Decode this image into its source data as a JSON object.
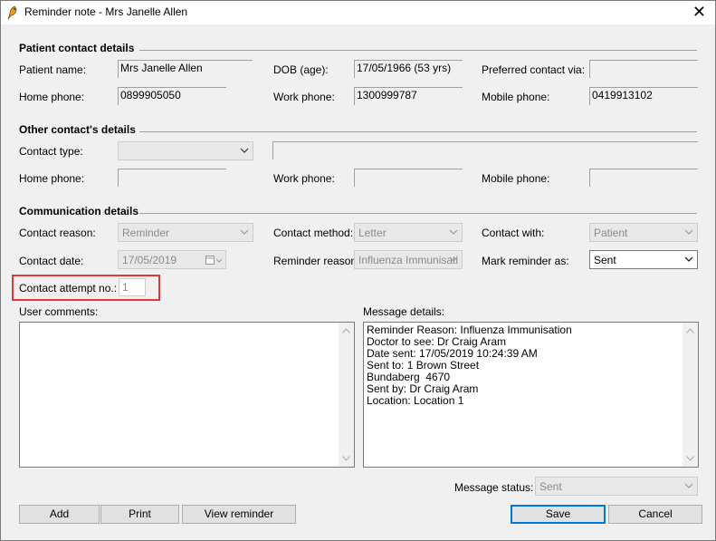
{
  "window": {
    "title": "Reminder note - Mrs Janelle Allen",
    "close_glyph": "✕"
  },
  "patient_section": {
    "title": "Patient contact details",
    "name_label": "Patient name:",
    "name_value": "Mrs Janelle Allen",
    "dob_label": "DOB (age):",
    "dob_value": "17/05/1966 (53 yrs)",
    "preferred_label": "Preferred contact via:",
    "preferred_value": "",
    "home_label": "Home phone:",
    "home_value": "0899905050",
    "work_label": "Work phone:",
    "work_value": "1300999787",
    "mobile_label": "Mobile phone:",
    "mobile_value": "0419913102"
  },
  "other_section": {
    "title": "Other contact's details",
    "type_label": "Contact type:",
    "type_value": "",
    "name_value": "",
    "home_label": "Home phone:",
    "home_value": "",
    "work_label": "Work phone:",
    "work_value": "",
    "mobile_label": "Mobile phone:",
    "mobile_value": ""
  },
  "comm_section": {
    "title": "Communication details",
    "reason_label": "Contact reason:",
    "reason_value": "Reminder",
    "method_label": "Contact method:",
    "method_value": "Letter",
    "with_label": "Contact with:",
    "with_value": "Patient",
    "date_label": "Contact date:",
    "date_value": "17/05/2019",
    "reminder_reason_label": "Reminder reason:",
    "reminder_reason_value": "Influenza Immunisati",
    "mark_label": "Mark reminder as:",
    "mark_value": "Sent",
    "attempt_label": "Contact attempt no.:",
    "attempt_value": "1"
  },
  "comments": {
    "label": "User comments:",
    "value": ""
  },
  "message": {
    "label": "Message details:",
    "lines": [
      "Reminder Reason: Influenza Immunisation",
      "Doctor to see: Dr Craig Aram",
      "Date sent: 17/05/2019 10:24:39 AM",
      "Sent to: 1 Brown Street",
      "Bundaberg  4670",
      "Sent by: Dr Craig Aram",
      "Location: Location 1"
    ],
    "status_label": "Message status:",
    "status_value": "Sent"
  },
  "buttons": {
    "add": "Add",
    "print": "Print",
    "view_reminder": "View reminder",
    "save": "Save",
    "cancel": "Cancel"
  },
  "colors": {
    "highlight": "#e0363c",
    "default_button_border": "#0078d7"
  }
}
